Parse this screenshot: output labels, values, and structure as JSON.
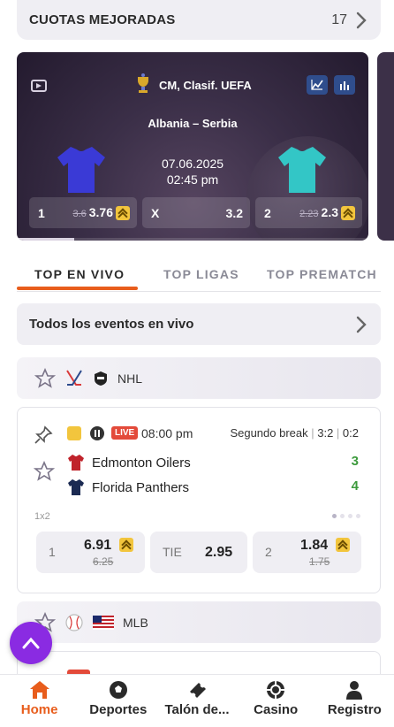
{
  "promo": {
    "title": "CUOTAS MEJORADAS",
    "count": "17"
  },
  "hero": {
    "competition": "CM, Clasif. UEFA",
    "match": "Albania – Serbia",
    "date": "07.06.2025",
    "time": "02:45 pm",
    "odds": [
      {
        "label": "1",
        "old": "3.6",
        "value": "3.76",
        "boosted": true
      },
      {
        "label": "X",
        "old": "",
        "value": "3.2",
        "boosted": false
      },
      {
        "label": "2",
        "old": "2.23",
        "value": "2.3",
        "boosted": true
      }
    ],
    "home_color": "#3a3ad6",
    "away_color": "#33c6c6"
  },
  "tabs": [
    "TOP EN VIVO",
    "TOP LIGAS",
    "TOP PREMATCH"
  ],
  "all_events": "Todos los eventos en vivo",
  "leagues": [
    {
      "name": "NHL"
    },
    {
      "name": "MLB"
    }
  ],
  "event": {
    "live_badge": "LIVE",
    "time": "08:00 pm",
    "status": "Segundo break",
    "period_score": "3:2",
    "period2_score": "0:2",
    "market": "1x2",
    "teams": [
      {
        "name": "Edmonton Oilers",
        "score": "3",
        "color": "#c0232b"
      },
      {
        "name": "Florida Panthers",
        "score": "4",
        "color": "#1b2a52"
      }
    ],
    "odds": [
      {
        "label": "1",
        "value": "6.91",
        "old": "6.25"
      },
      {
        "label": "TIE",
        "value": "2.95",
        "old": ""
      },
      {
        "label": "2",
        "value": "1.84",
        "old": "1.75"
      }
    ]
  },
  "nav": [
    {
      "label": "Home",
      "active": true
    },
    {
      "label": "Deportes"
    },
    {
      "label": "Talón de..."
    },
    {
      "label": "Casino"
    },
    {
      "label": "Registro"
    }
  ],
  "colors": {
    "accent": "#e85d1c",
    "boost": "#f2c53d",
    "live": "#e34a3a",
    "fab": "#8a2be2",
    "win": "#3c9a3c"
  }
}
